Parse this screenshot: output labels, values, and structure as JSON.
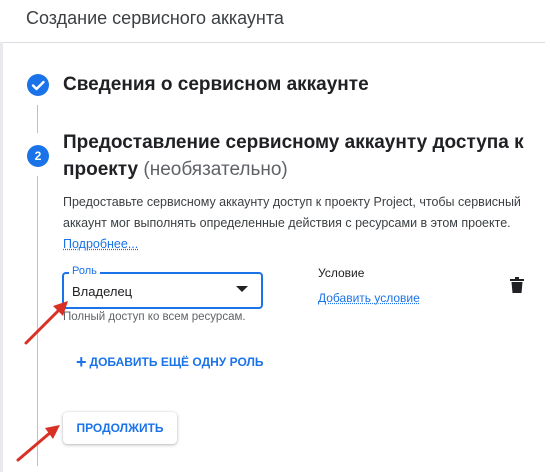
{
  "header": {
    "title": "Создание сервисного аккаунта"
  },
  "step1": {
    "title": "Сведения о сервисном аккаунте"
  },
  "step2": {
    "number": "2",
    "title": "Предоставление сервисному аккаунту доступа к проекту",
    "optional_label": "(необязательно)",
    "description": "Предоставьте сервисному аккаунту доступ к проекту Project, чтобы сервисный аккаунт мог выполнять определенные действия с ресурсами в этом проекте.",
    "learn_more": "Подробнее...",
    "role": {
      "label": "Роль",
      "value": "Владелец",
      "hint": "Полный доступ ко всем ресурсам."
    },
    "condition": {
      "title": "Условие",
      "add_link": "Добавить условие"
    },
    "add_role_button": "ДОБАВИТЬ ЕЩЁ ОДНУ РОЛЬ",
    "continue_button": "ПРОДОЛЖИТЬ"
  },
  "colors": {
    "accent": "#1a73e8",
    "annotation_arrow": "#d93025"
  },
  "icons": {
    "step1_status": "check-icon",
    "delete_role": "trash-icon",
    "role_dropdown": "chevron-down-icon",
    "add_role": "plus-icon"
  }
}
